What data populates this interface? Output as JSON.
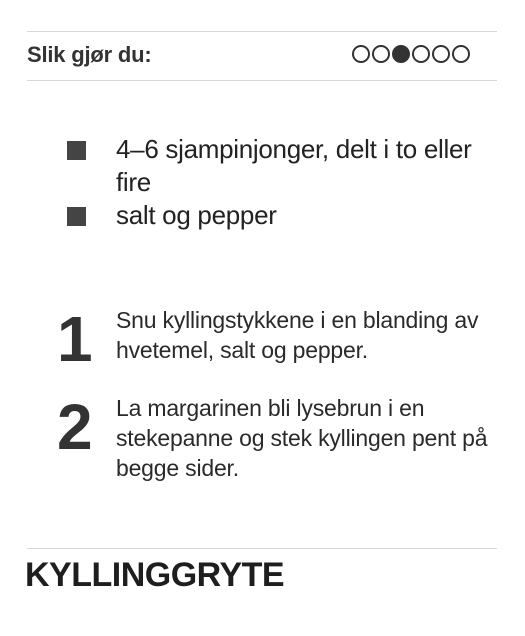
{
  "header": {
    "title": "Slik gjør du:",
    "difficulty": {
      "level": 3,
      "max": 6
    }
  },
  "ingredients": [
    "4–6 sjampinjonger, delt i to eller fire",
    "salt og pepper"
  ],
  "steps": [
    {
      "number": "1",
      "text": "Snu kyllingstykkene i en blanding av hvetemel, salt og pepper."
    },
    {
      "number": "2",
      "text": "La margarinen bli lysebrun i en stekepanne og stek kyllingen pent på begge sider."
    }
  ],
  "recipe": {
    "title": "KYLLINGGRYTE"
  },
  "colors": {
    "text": "#2a2a2a",
    "rule": "#d8d8d8",
    "accent": "#333333"
  }
}
